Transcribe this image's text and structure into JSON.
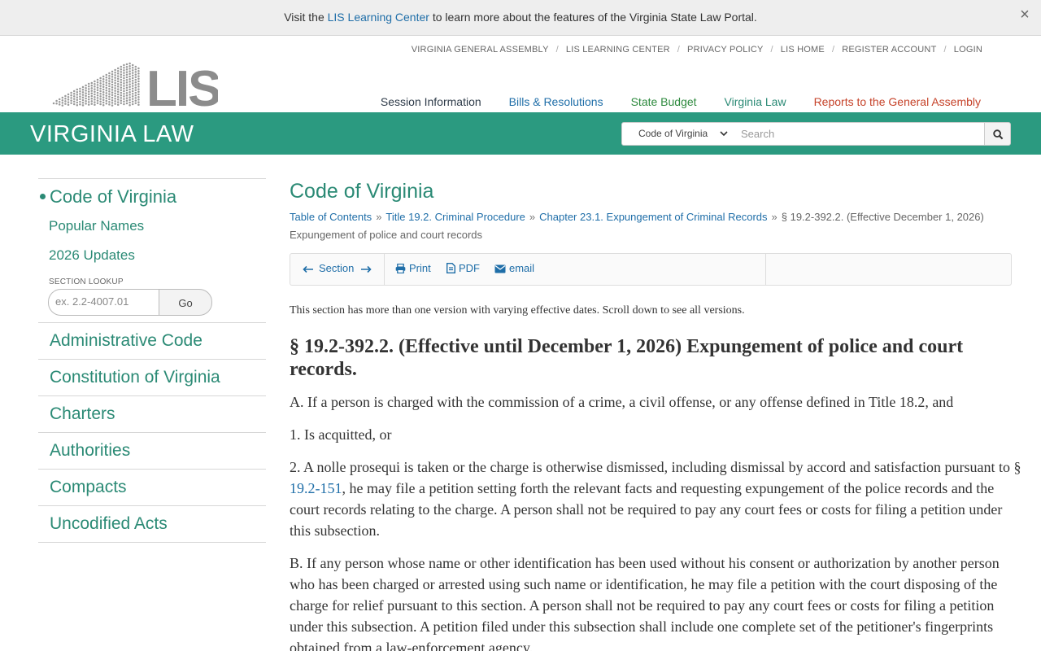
{
  "banner": {
    "prefix": "Visit the ",
    "link": "LIS Learning Center",
    "suffix": " to learn more about the features of the Virginia State Law Portal.",
    "close": "×"
  },
  "logo": {
    "text": "LIS"
  },
  "top_links": [
    "VIRGINIA GENERAL ASSEMBLY",
    "LIS LEARNING CENTER",
    "PRIVACY POLICY",
    "LIS HOME",
    "REGISTER ACCOUNT",
    "LOGIN"
  ],
  "top_links_sep": "/",
  "main_nav": [
    {
      "label": "Session Information",
      "color": "#2f3c4a"
    },
    {
      "label": "Bills & Resolutions",
      "color": "#1f6ea8"
    },
    {
      "label": "State Budget",
      "color": "#2e8a3e"
    },
    {
      "label": "Virginia Law",
      "color": "#2b8a75"
    },
    {
      "label": "Reports to the General Assembly",
      "color": "#c6432a"
    }
  ],
  "greenbar": {
    "title": "VIRGINIA LAW",
    "select_value": "Code of Virginia",
    "search_placeholder": "Search"
  },
  "sidebar": {
    "main": "Code of Virginia",
    "subs": [
      "Popular Names",
      "2026 Updates"
    ],
    "lookup_label": "SECTION LOOKUP",
    "lookup_placeholder": "ex. 2.2-4007.01",
    "lookup_go": "Go",
    "items": [
      "Administrative Code",
      "Constitution of Virginia",
      "Charters",
      "Authorities",
      "Compacts",
      "Uncodified Acts"
    ]
  },
  "content": {
    "heading": "Code of Virginia",
    "breadcrumb": [
      "Table of Contents",
      "Title 19.2. Criminal Procedure",
      "Chapter 23.1. Expungement of Criminal Records"
    ],
    "breadcrumb_current": "§ 19.2-392.2. (Effective December 1, 2026) Expungement of police and court records",
    "breadcrumb_sep": "»",
    "toolbar": {
      "section": "Section",
      "print": "Print",
      "pdf": "PDF",
      "email": "email"
    },
    "version_note": "This section has more than one version with varying effective dates. Scroll down to see all versions.",
    "section_title": "§ 19.2-392.2. (Effective until December 1, 2026) Expungement of police and court records.",
    "para_a": "A. If a person is charged with the commission of a crime, a civil offense, or any offense defined in Title 18.2, and",
    "para_1": "1. Is acquitted, or",
    "para_2_pre": "2. A nolle prosequi is taken or the charge is otherwise dismissed, including dismissal by accord and satisfaction pursuant to § ",
    "para_2_ref": "19.2-151",
    "para_2_post": ", he may file a petition setting forth the relevant facts and requesting expungement of the police records and the court records relating to the charge. A person shall not be required to pay any court fees or costs for filing a petition under this subsection.",
    "para_b": "B. If any person whose name or other identification has been used without his consent or authorization by another person who has been charged or arrested using such name or identification, he may file a petition with the court disposing of the charge for relief pursuant to this section. A person shall not be required to pay any court fees or costs for filing a petition under this subsection. A petition filed under this subsection shall include one complete set of the petitioner's fingerprints obtained from a law-enforcement agency."
  }
}
